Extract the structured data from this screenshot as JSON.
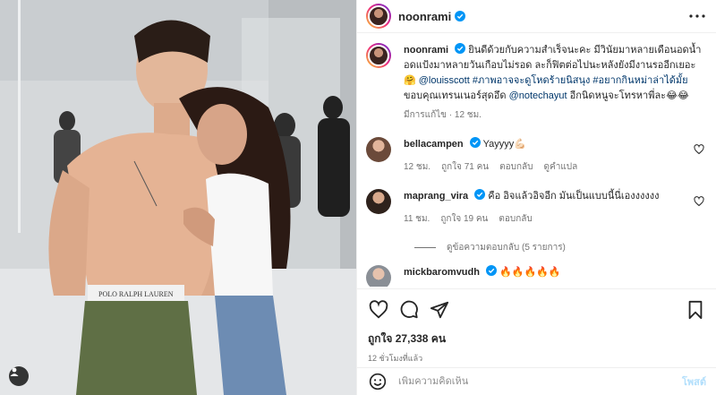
{
  "media": {
    "description": "",
    "waistband_text": "POLO RALPH LAUREN",
    "tag_icon": "user-tag-icon"
  },
  "header": {
    "username": "noonrami",
    "verified_icon": "verified-badge-icon",
    "more_icon": "more-horizontal-icon"
  },
  "caption": {
    "username": "noonrami",
    "text_1": "ยินดีด้วยกับความสำเร็จนะคะ มีวินัยมาหลายเดือนอดน้ำ อดแป้งมาหลายวันเกือบไม่รอด ละก็ฟิตต่อไปนะหลังยังมีงานรออีกเยอะ",
    "emoji_1": "🤗",
    "mention_1": "@louisscott",
    "hashtag_1": "#ภาพอาจจะดูโหดร้ายนิสนุง",
    "hashtag_2": "#อยากกินหม่าล่าได้มั้ย",
    "text_2": "ขอบคุณเทรนเนอร์สุดอึด",
    "mention_2": "@notechayut",
    "text_3": "อีกนิดหนูจะโทรหาพี่ละ",
    "emoji_2": "😂😂",
    "meta": "มีการแก้ไข · 12 ชม."
  },
  "comments": [
    {
      "username": "bellacampen",
      "verified": true,
      "text": "Yayyyy💪🏻",
      "time": "12 ชม.",
      "likes": "ถูกใจ 71 คน",
      "reply": "ตอบกลับ",
      "translate": "ดูคำแปล"
    },
    {
      "username": "maprang_vira",
      "verified": true,
      "text": "คือ อิจแล้วอิจอีก มันเป็นแบบนี้นี่เองงงงงง",
      "time": "11 ชม.",
      "likes": "ถูกใจ 19 คน",
      "reply": "ตอบกลับ"
    },
    {
      "username": "mickbaromvudh",
      "verified": true,
      "text": "🔥🔥🔥🔥🔥"
    }
  ],
  "view_replies": "ดูข้อความตอบกลับ (5 รายการ)",
  "actions": {
    "like_icon": "heart-icon",
    "comment_icon": "comment-icon",
    "share_icon": "share-icon",
    "save_icon": "bookmark-icon",
    "likes_text": "ถูกใจ 27,338 คน",
    "time_ago": "12 ชั่วโมงที่แล้ว"
  },
  "add_comment": {
    "emoji_icon": "emoji-icon",
    "placeholder": "เพิ่มความคิดเห็น",
    "post_label": "โพสต์"
  },
  "colors": {
    "link": "#00376b",
    "verified": "#0095f6",
    "muted": "#737373",
    "post_disabled": "#b2dffc"
  }
}
